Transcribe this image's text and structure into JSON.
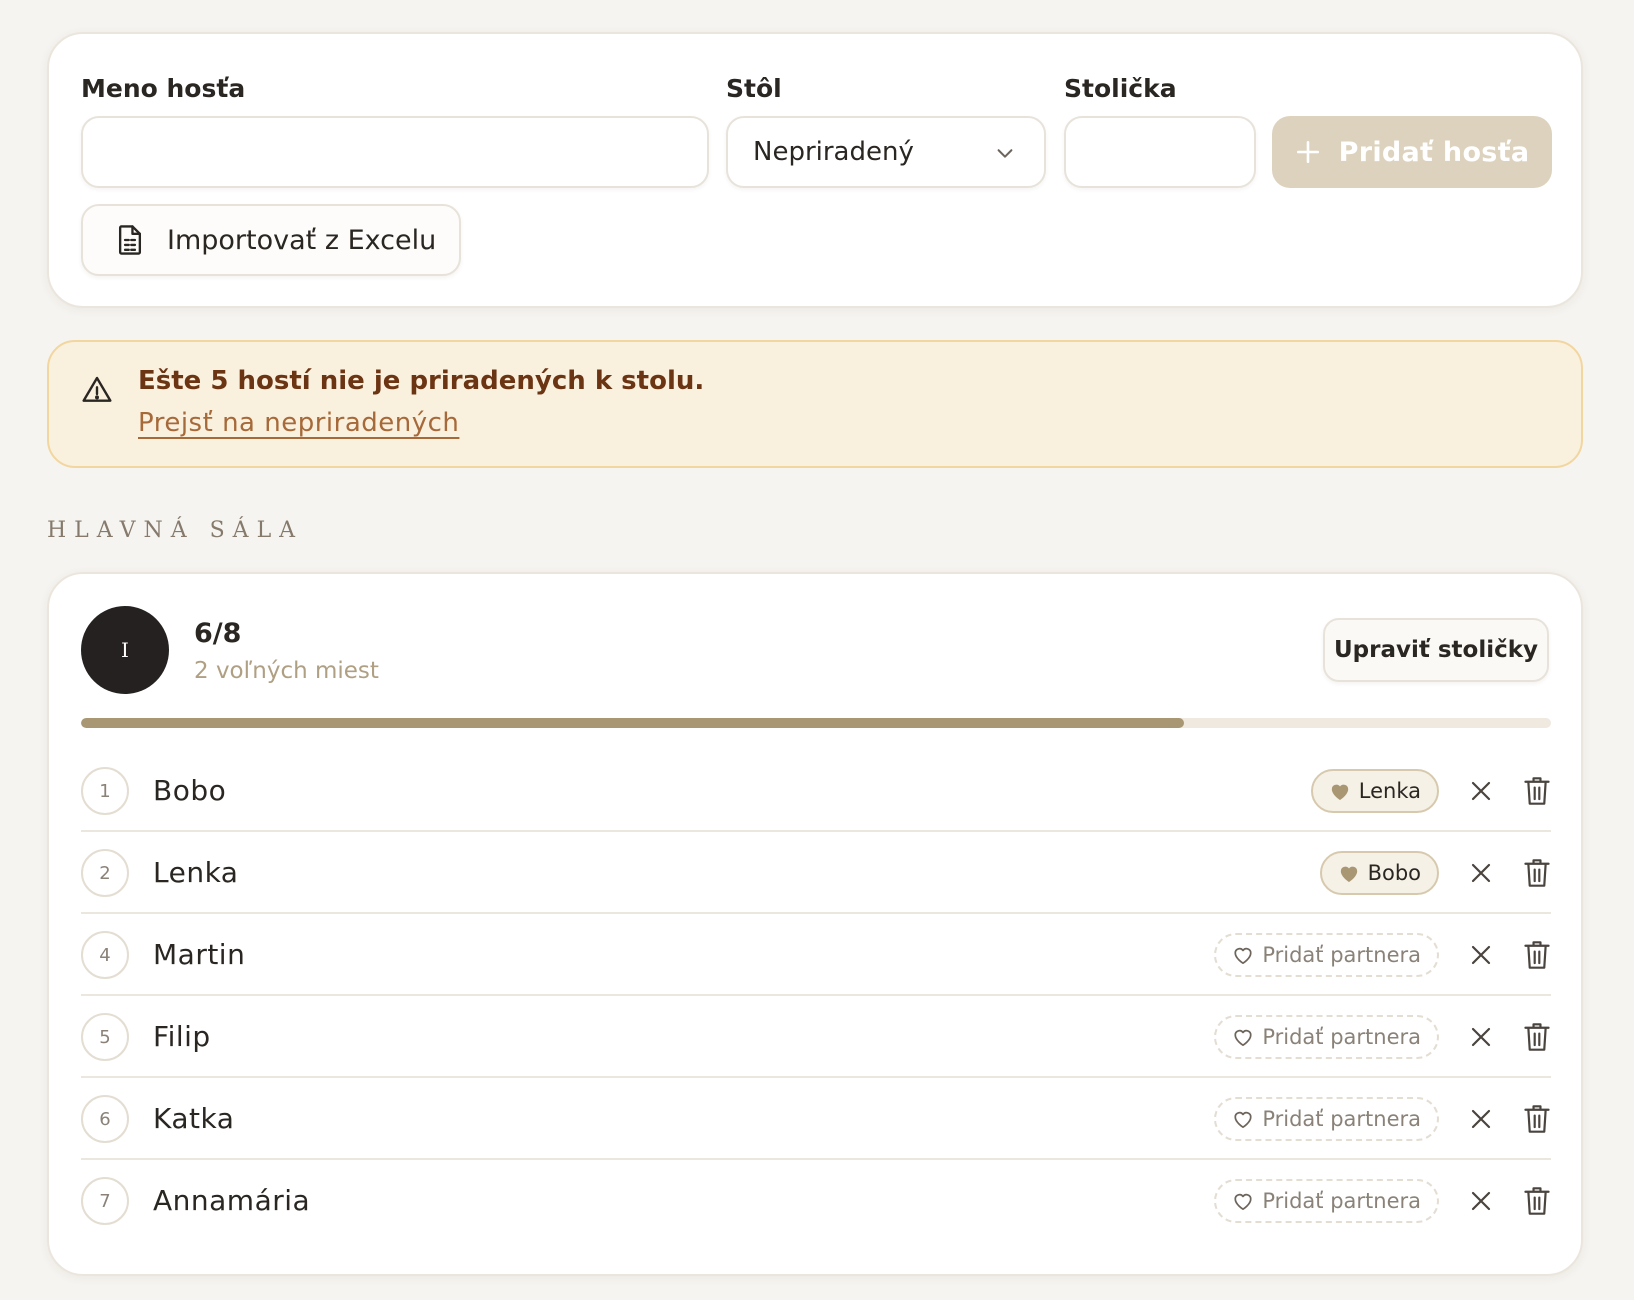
{
  "form": {
    "name_label": "Meno hosťa",
    "name_value": "",
    "table_label": "Stôl",
    "table_selected": "Nepriradený",
    "chair_label": "Stolička",
    "chair_value": "",
    "add_button": "Pridať hosťa",
    "import_button": "Importovať z Excelu"
  },
  "warning": {
    "message": "Ešte 5 hostí nie je priradených k stolu.",
    "link": "Prejsť na nepriradených"
  },
  "section_title": "HLAVNÁ SÁLA",
  "table": {
    "avatar_label": "I",
    "occupancy": "6/8",
    "free_seats": "2 voľných miest",
    "edit_button": "Upraviť stoličky",
    "fill_fraction": 0.75,
    "guests": [
      {
        "seat": "1",
        "name": "Bobo",
        "partner": "Lenka",
        "has_partner": true
      },
      {
        "seat": "2",
        "name": "Lenka",
        "partner": "Bobo",
        "has_partner": true
      },
      {
        "seat": "4",
        "name": "Martin",
        "partner": "Pridať partnera",
        "has_partner": false
      },
      {
        "seat": "5",
        "name": "Filip",
        "partner": "Pridať partnera",
        "has_partner": false
      },
      {
        "seat": "6",
        "name": "Katka",
        "partner": "Pridať partnera",
        "has_partner": false
      },
      {
        "seat": "7",
        "name": "Annamária",
        "partner": "Pridať partnera",
        "has_partner": false
      }
    ]
  },
  "colors": {
    "accent": "#a99773",
    "warning_bg": "#faf0de",
    "warning_text": "#6b3413",
    "link": "#a66a3a"
  },
  "icons": {
    "add": "plus-icon",
    "import": "spreadsheet-file-icon",
    "select": "chevron-down-icon",
    "warning": "warning-triangle-icon",
    "partner_filled": "heart-filled-icon",
    "partner_empty": "heart-outline-icon",
    "remove": "close-icon",
    "delete": "trash-icon"
  }
}
